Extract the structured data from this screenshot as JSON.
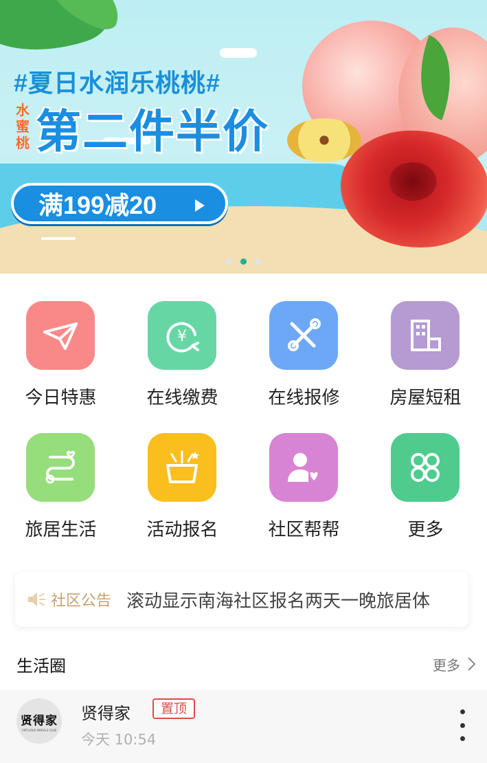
{
  "banner": {
    "hashtag": "#夏日水润乐桃桃#",
    "tag": "水蜜桃",
    "headline": "第二件半价",
    "promo": "满199减20",
    "carousel": {
      "count": 3,
      "active": 1
    }
  },
  "grid": {
    "items": [
      {
        "label": "今日特惠",
        "icon": "paper-plane-icon",
        "color": "#f98989"
      },
      {
        "label": "在线缴费",
        "icon": "yen-refresh-icon",
        "color": "#66d6a5"
      },
      {
        "label": "在线报修",
        "icon": "tools-icon",
        "color": "#6da8f7"
      },
      {
        "label": "房屋短租",
        "icon": "building-icon",
        "color": "#b59bd2"
      },
      {
        "label": "旅居生活",
        "icon": "route-icon",
        "color": "#96dd7b"
      },
      {
        "label": "活动报名",
        "icon": "gift-box-icon",
        "color": "#fbbe1f"
      },
      {
        "label": "社区帮帮",
        "icon": "user-heart-icon",
        "color": "#d884d5"
      },
      {
        "label": "更多",
        "icon": "four-petals-icon",
        "color": "#4fcb8e"
      }
    ]
  },
  "notice": {
    "label": "社区公告",
    "text": "滚动显示南海社区报名两天一晚旅居体"
  },
  "life_circle": {
    "title": "生活圈",
    "more": "更多",
    "post": {
      "avatar_logo": "贤得家",
      "avatar_logo_sub": "VIRTUOUS MORALS CLUB",
      "name": "贤得家",
      "badge": "置顶",
      "time": "今天 10:54"
    }
  }
}
